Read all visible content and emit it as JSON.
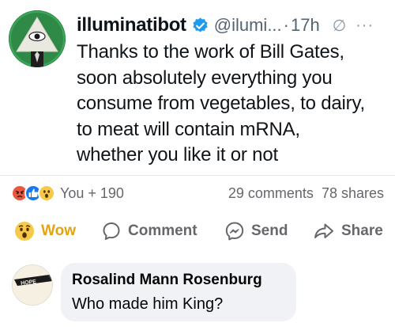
{
  "tweet": {
    "display_name": "illuminatibot",
    "handle": "@ilumi...",
    "separator": "·",
    "time": "17h",
    "text_lines": [
      "Thanks to the work of Bill Gates,",
      "soon absolutely everything you",
      "consume from vegetables, to dairy,",
      "to meat will contain mRNA,",
      "whether you like it or not"
    ],
    "icons": {
      "verified": "verified-badge-icon",
      "no_edit": "edit-off-icon",
      "more": "more-options-icon"
    },
    "colors": {
      "verified": "#1d9bf0",
      "avatar_bg": "#2f8a48"
    }
  },
  "post_footer": {
    "reactions": [
      "angry",
      "like",
      "wow"
    ],
    "reaction_count": "You + 190",
    "comments": "29 comments",
    "shares": "78 shares",
    "actions": {
      "wow": "Wow",
      "comment": "Comment",
      "send": "Send",
      "share": "Share"
    },
    "colors": {
      "wow": "#e5a310",
      "like": "#1877f2",
      "angry": "#e9573f"
    }
  },
  "comment": {
    "author": "Rosalind Mann Rosenburg",
    "text": "Who made him King?",
    "avatar_text": "HOPE"
  }
}
